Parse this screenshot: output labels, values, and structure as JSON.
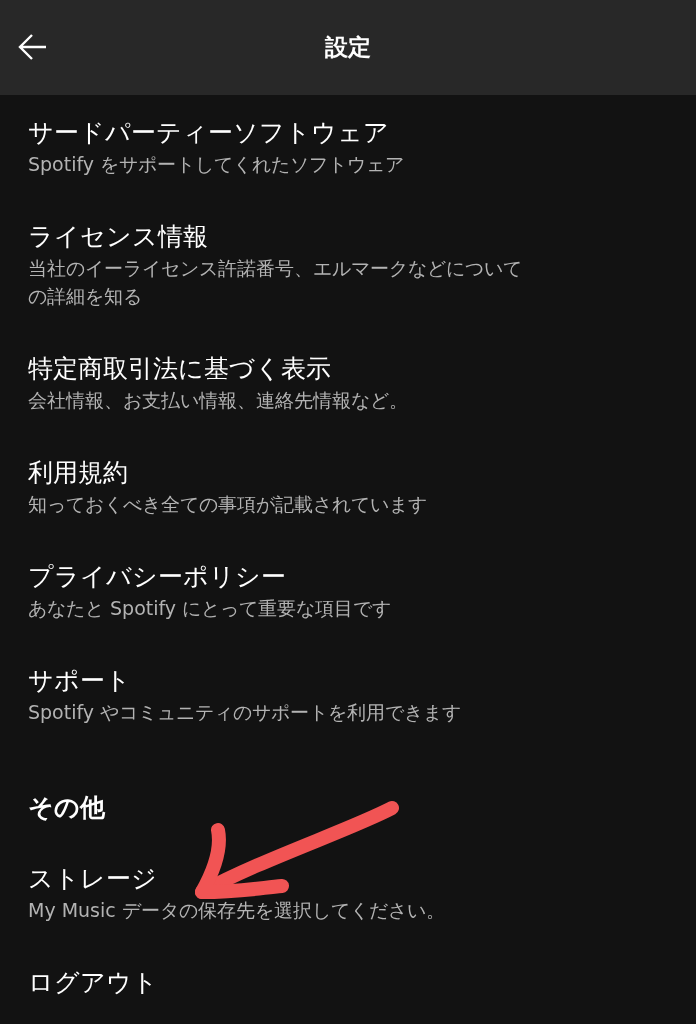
{
  "header": {
    "title": "設定"
  },
  "items": [
    {
      "kind": "setting",
      "title": "サードパーティーソフトウェア",
      "subtitle": "Spotify をサポートしてくれたソフトウェア"
    },
    {
      "kind": "setting",
      "title": "ライセンス情報",
      "subtitle": "当社のイーライセンス許諾番号、エルマークなどについての詳細を知る"
    },
    {
      "kind": "setting",
      "title": "特定商取引法に基づく表示",
      "subtitle": "会社情報、お支払い情報、連絡先情報など。"
    },
    {
      "kind": "setting",
      "title": "利用規約",
      "subtitle": "知っておくべき全ての事項が記載されています"
    },
    {
      "kind": "setting",
      "title": "プライバシーポリシー",
      "subtitle": "あなたと Spotify にとって重要な項目です"
    },
    {
      "kind": "setting",
      "title": "サポート",
      "subtitle": "Spotify やコミュニティのサポートを利用できます"
    },
    {
      "kind": "section",
      "title": "その他"
    },
    {
      "kind": "setting",
      "title": "ストレージ",
      "subtitle": "My Music データの保存先を選択してください。"
    },
    {
      "kind": "setting",
      "title": "ログアウト"
    }
  ]
}
